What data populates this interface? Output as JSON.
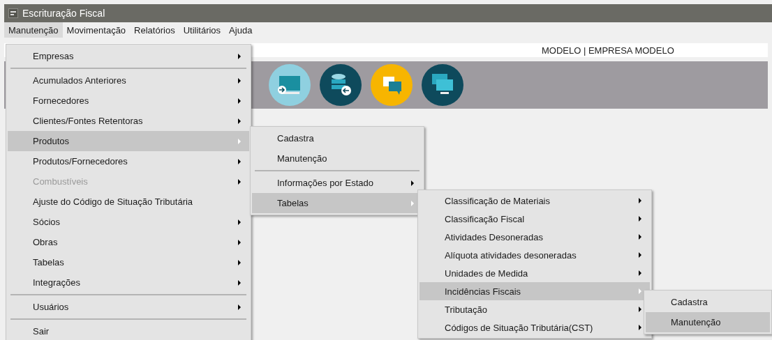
{
  "window": {
    "title": "Escrituração Fiscal"
  },
  "menubar": [
    {
      "label": "Manutenção",
      "selected": true
    },
    {
      "label": "Movimentação",
      "selected": false
    },
    {
      "label": "Relatórios",
      "selected": false
    },
    {
      "label": "Utilitários",
      "selected": false
    },
    {
      "label": "Ajuda",
      "selected": false
    }
  ],
  "company_label": "MODELO | EMPRESA MODELO",
  "toolbar_icons": [
    {
      "kind": "monitor"
    },
    {
      "kind": "database"
    },
    {
      "kind": "chat"
    },
    {
      "kind": "screens"
    }
  ],
  "menus": [
    {
      "items": [
        {
          "kind": "submenu",
          "label": "Empresas",
          "selected": false,
          "disabled": false
        },
        {
          "kind": "separator"
        },
        {
          "kind": "submenu",
          "label": "Acumulados Anteriores",
          "selected": false,
          "disabled": false
        },
        {
          "kind": "submenu",
          "label": "Fornecedores",
          "selected": false,
          "disabled": false
        },
        {
          "kind": "submenu",
          "label": "Clientes/Fontes Retentoras",
          "selected": false,
          "disabled": false
        },
        {
          "kind": "submenu",
          "label": "Produtos",
          "selected": true,
          "disabled": false
        },
        {
          "kind": "submenu",
          "label": "Produtos/Fornecedores",
          "selected": false,
          "disabled": false
        },
        {
          "kind": "submenu",
          "label": "Combustíveis",
          "selected": false,
          "disabled": true
        },
        {
          "kind": "command",
          "label": "Ajuste do Código de Situação Tributária",
          "selected": false,
          "disabled": false
        },
        {
          "kind": "submenu",
          "label": "Sócios",
          "selected": false,
          "disabled": false
        },
        {
          "kind": "submenu",
          "label": "Obras",
          "selected": false,
          "disabled": false
        },
        {
          "kind": "submenu",
          "label": "Tabelas",
          "selected": false,
          "disabled": false
        },
        {
          "kind": "submenu",
          "label": "Integrações",
          "selected": false,
          "disabled": false
        },
        {
          "kind": "separator"
        },
        {
          "kind": "submenu",
          "label": "Usuários",
          "selected": false,
          "disabled": false
        },
        {
          "kind": "separator"
        },
        {
          "kind": "command",
          "label": "Sair",
          "selected": false,
          "disabled": false
        }
      ]
    },
    {
      "items": [
        {
          "kind": "command",
          "label": "Cadastra",
          "selected": false,
          "disabled": false
        },
        {
          "kind": "command",
          "label": "Manutenção",
          "selected": false,
          "disabled": false
        },
        {
          "kind": "separator"
        },
        {
          "kind": "submenu",
          "label": "Informações por Estado",
          "selected": false,
          "disabled": false
        },
        {
          "kind": "submenu",
          "label": "Tabelas",
          "selected": true,
          "disabled": false
        }
      ]
    },
    {
      "items": [
        {
          "kind": "submenu",
          "label": "Classificação de Materiais",
          "selected": false,
          "disabled": false
        },
        {
          "kind": "submenu",
          "label": "Classificação Fiscal",
          "selected": false,
          "disabled": false
        },
        {
          "kind": "submenu",
          "label": "Atividades Desoneradas",
          "selected": false,
          "disabled": false
        },
        {
          "kind": "submenu",
          "label": "Alíquota atividades desoneradas",
          "selected": false,
          "disabled": false
        },
        {
          "kind": "submenu",
          "label": "Unidades de Medida",
          "selected": false,
          "disabled": false
        },
        {
          "kind": "submenu",
          "label": "Incidências Fiscais",
          "selected": true,
          "disabled": false
        },
        {
          "kind": "submenu",
          "label": "Tributação",
          "selected": false,
          "disabled": false
        },
        {
          "kind": "submenu",
          "label": "Códigos de Situação Tributária(CST)",
          "selected": false,
          "disabled": false
        }
      ]
    },
    {
      "items": [
        {
          "kind": "command",
          "label": "Cadastra",
          "selected": false,
          "disabled": false
        },
        {
          "kind": "command",
          "label": "Manutenção",
          "selected": true,
          "disabled": false
        }
      ]
    }
  ]
}
